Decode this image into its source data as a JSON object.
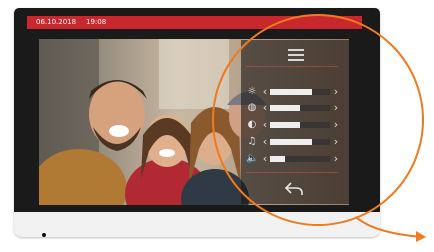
{
  "status_bar": {
    "date": "06.10.2018",
    "time": "19:08",
    "color": "#c8272d"
  },
  "video": {
    "description_icon": "video-feed-image"
  },
  "settings_panel": {
    "menu_icon": "hamburger-icon",
    "rows": [
      {
        "name": "brightness",
        "icon": "sun-icon",
        "glyph": "☼",
        "level": 0.7
      },
      {
        "name": "color",
        "icon": "palette-icon",
        "glyph": "◍",
        "level": 0.5
      },
      {
        "name": "contrast",
        "icon": "contrast-icon",
        "glyph": "◐",
        "level": 0.5
      },
      {
        "name": "ring-volume",
        "icon": "bell-icon",
        "glyph": "♫",
        "level": 0.7
      },
      {
        "name": "speaker-volume",
        "icon": "speaker-icon",
        "glyph": "🔈",
        "level": 0.25
      }
    ],
    "back_icon": "back-arrow-icon"
  },
  "annotation": {
    "circle_color": "#f07b1d",
    "arrow_color": "#f07b1d"
  }
}
